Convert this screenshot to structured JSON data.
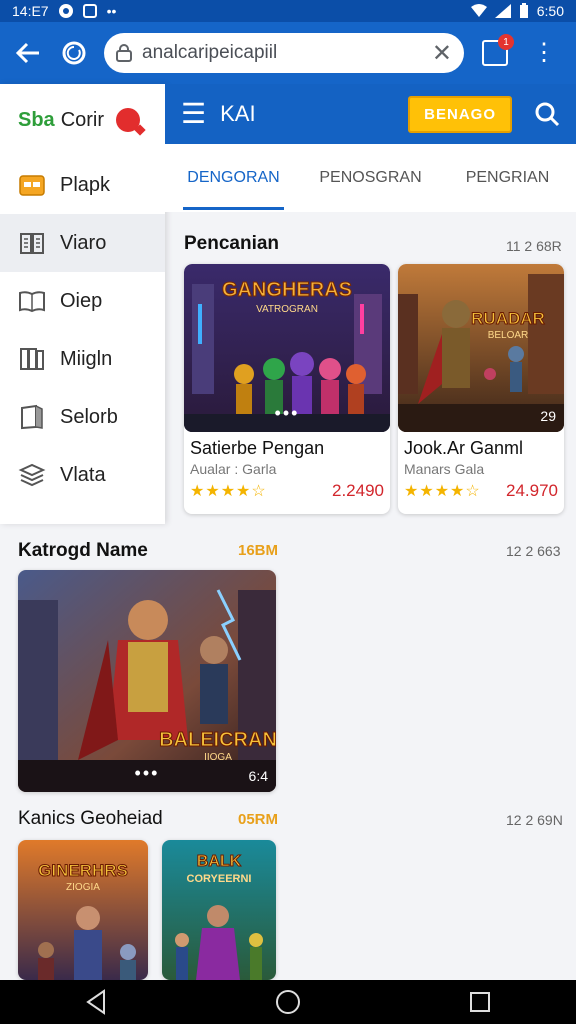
{
  "status": {
    "time": "14:E7",
    "clock": "6:50"
  },
  "browser": {
    "url": "analcaripeicapiil",
    "tabs_badge": "1"
  },
  "sidebar": {
    "brand_left": "Sba",
    "brand_right": "Corir",
    "items": [
      {
        "label": "Plapk",
        "icon": "folder-icon"
      },
      {
        "label": "Viaro",
        "icon": "book-icon"
      },
      {
        "label": "Oiep",
        "icon": "book-open-icon"
      },
      {
        "label": "Miigln",
        "icon": "book-icon"
      },
      {
        "label": "Selorb",
        "icon": "book-icon"
      },
      {
        "label": "Vlata",
        "icon": "stack-icon"
      }
    ]
  },
  "appbar": {
    "title": "KAI",
    "button": "BENAGO"
  },
  "tabs": [
    "DENGORAN",
    "PENOSGRAN",
    "PENGRIAN"
  ],
  "section1": {
    "title": "Pencanian",
    "meta": "11 2 68R",
    "cards": [
      {
        "title": "Satierbe Pengan",
        "subtitle": "Aualar : Garla",
        "stars": "★★★★☆",
        "price": "2.2490",
        "thumb_title": "GANGHERAS",
        "thumb_sub": "VATROGRAN",
        "dots": "•••",
        "badge": ""
      },
      {
        "title": "Jook.Ar Ganml",
        "subtitle": "Manars Gala",
        "stars": "★★★★☆",
        "price": "24.970",
        "thumb_title": "RUADAR",
        "thumb_sub": "BELOAR",
        "dots": "",
        "badge": "29"
      }
    ]
  },
  "section2": {
    "title": "Katrogd Name",
    "size": "16BM",
    "meta": "12 2 663",
    "thumb": {
      "title": "BALEICRAN",
      "sub": "IIOGA",
      "dots": "•••",
      "badge": "6:4"
    }
  },
  "section3": {
    "title": "Kanics Geoheiad",
    "size": "05RM",
    "meta": "12 2 69N",
    "thumbs": [
      {
        "title": "GINERHRS",
        "sub": "ZIOGIA"
      },
      {
        "title": "BALK",
        "sub": "CORYEERNI"
      }
    ]
  },
  "colors": {
    "primary": "#1565c8",
    "accent": "#ffc107",
    "price": "#d2262c",
    "star": "#f4b400"
  }
}
